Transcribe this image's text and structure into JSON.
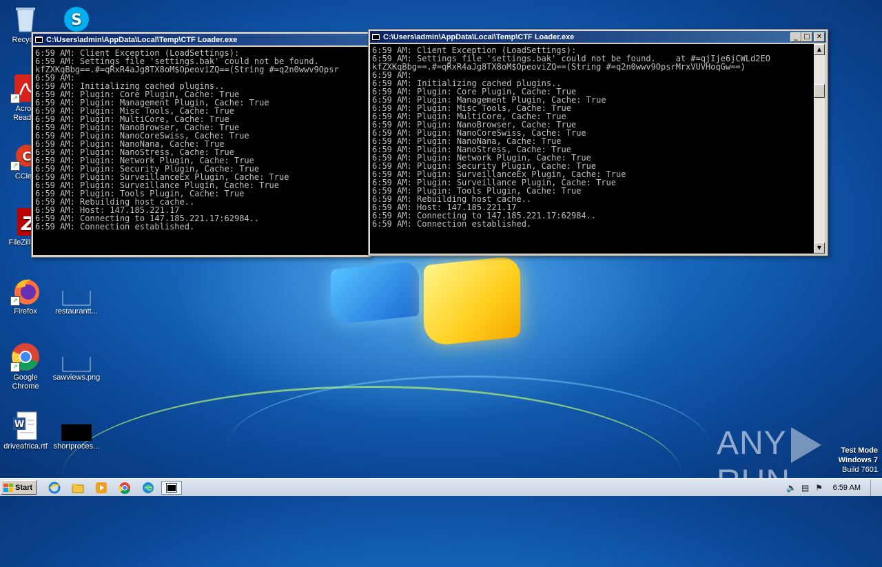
{
  "desktop": {
    "icons": [
      {
        "label": "Recycle",
        "icon": "recycle-bin-icon"
      },
      {
        "label": "Acrob\nReader",
        "icon": "acrobat-reader-icon"
      },
      {
        "label": "CClea",
        "icon": "ccleaner-icon"
      },
      {
        "label": "FileZilla C",
        "icon": "filezilla-icon"
      },
      {
        "label": "Firefox",
        "icon": "firefox-icon"
      },
      {
        "label": "restaurantt...",
        "icon": "file-icon"
      },
      {
        "label": "Google\nChrome",
        "icon": "chrome-icon"
      },
      {
        "label": "sawviews.png",
        "icon": "image-file-icon"
      },
      {
        "label": "driveafrica.rtf",
        "icon": "word-document-icon"
      },
      {
        "label": "shortproces...",
        "icon": "black-thumbnail-icon"
      },
      {
        "label": "",
        "icon": "skype-icon"
      }
    ]
  },
  "window_left": {
    "title": "C:\\Users\\admin\\AppData\\Local\\Temp\\CTF Loader.exe",
    "lines": [
      "6:59 AM: Client Exception (LoadSettings):",
      "6:59 AM: Settings file 'settings.bak' could not be found.",
      "kfZXKqBbg==.#=qRxR4aJg8TX8oM$OpeoviZQ==(String #=q2n0wwv9Opsr",
      "6:59 AM:",
      "6:59 AM: Initializing cached plugins..",
      "6:59 AM: Plugin: Core Plugin, Cache: True",
      "6:59 AM: Plugin: Management Plugin, Cache: True",
      "6:59 AM: Plugin: Misc Tools, Cache: True",
      "6:59 AM: Plugin: MultiCore, Cache: True",
      "6:59 AM: Plugin: NanoBrowser, Cache: True",
      "6:59 AM: Plugin: NanoCoreSwiss, Cache: True",
      "6:59 AM: Plugin: NanoNana, Cache: True",
      "6:59 AM: Plugin: NanoStress, Cache: True",
      "6:59 AM: Plugin: Network Plugin, Cache: True",
      "6:59 AM: Plugin: Security Plugin, Cache: True",
      "6:59 AM: Plugin: SurveillanceEx Plugin, Cache: True",
      "6:59 AM: Plugin: Surveillance Plugin, Cache: True",
      "6:59 AM: Plugin: Tools Plugin, Cache: True",
      "6:59 AM: Rebuilding host cache..",
      "6:59 AM: Host: 147.185.221.17",
      "6:59 AM: Connecting to 147.185.221.17:62984..",
      "6:59 AM: Connection established."
    ]
  },
  "window_right": {
    "title": "C:\\Users\\admin\\AppData\\Local\\Temp\\CTF Loader.exe",
    "minimize": "_",
    "maximize": "□",
    "close": "✕",
    "lines": [
      "6:59 AM: Client Exception (LoadSettings):",
      "6:59 AM: Settings file 'settings.bak' could not be found.    at #=qjIje6jCWLd2EO",
      "kfZXKqBbg==.#=qRxR4aJg8TX8oM$OpeoviZQ==(String #=q2n0wwv9OpsrMrxVUVHoqGw==)",
      "6:59 AM:",
      "6:59 AM: Initializing cached plugins..",
      "6:59 AM: Plugin: Core Plugin, Cache: True",
      "6:59 AM: Plugin: Management Plugin, Cache: True",
      "6:59 AM: Plugin: Misc Tools, Cache: True",
      "6:59 AM: Plugin: MultiCore, Cache: True",
      "6:59 AM: Plugin: NanoBrowser, Cache: True",
      "6:59 AM: Plugin: NanoCoreSwiss, Cache: True",
      "6:59 AM: Plugin: NanoNana, Cache: True",
      "6:59 AM: Plugin: NanoStress, Cache: True",
      "6:59 AM: Plugin: Network Plugin, Cache: True",
      "6:59 AM: Plugin: Security Plugin, Cache: True",
      "6:59 AM: Plugin: SurveillanceEx Plugin, Cache: True",
      "6:59 AM: Plugin: Surveillance Plugin, Cache: True",
      "6:59 AM: Plugin: Tools Plugin, Cache: True",
      "6:59 AM: Rebuilding host cache..",
      "6:59 AM: Host: 147.185.221.17",
      "6:59 AM: Connecting to 147.185.221.17:62984..",
      "6:59 AM: Connection established."
    ]
  },
  "watermark": {
    "brand_left": "ANY",
    "brand_right": "RUN",
    "test_mode": "Test Mode",
    "os": "Windows 7",
    "build": "Build 7601"
  },
  "taskbar": {
    "start_label": "Start",
    "pinned": [
      "ie-icon",
      "explorer-icon",
      "media-player-icon",
      "chrome-icon",
      "edge-icon",
      "console-window-icon"
    ],
    "clock": "6:59 AM"
  },
  "colors": {
    "title_active": "#0a246a",
    "console_bg": "#000000",
    "console_fg": "#c0c0c0"
  }
}
